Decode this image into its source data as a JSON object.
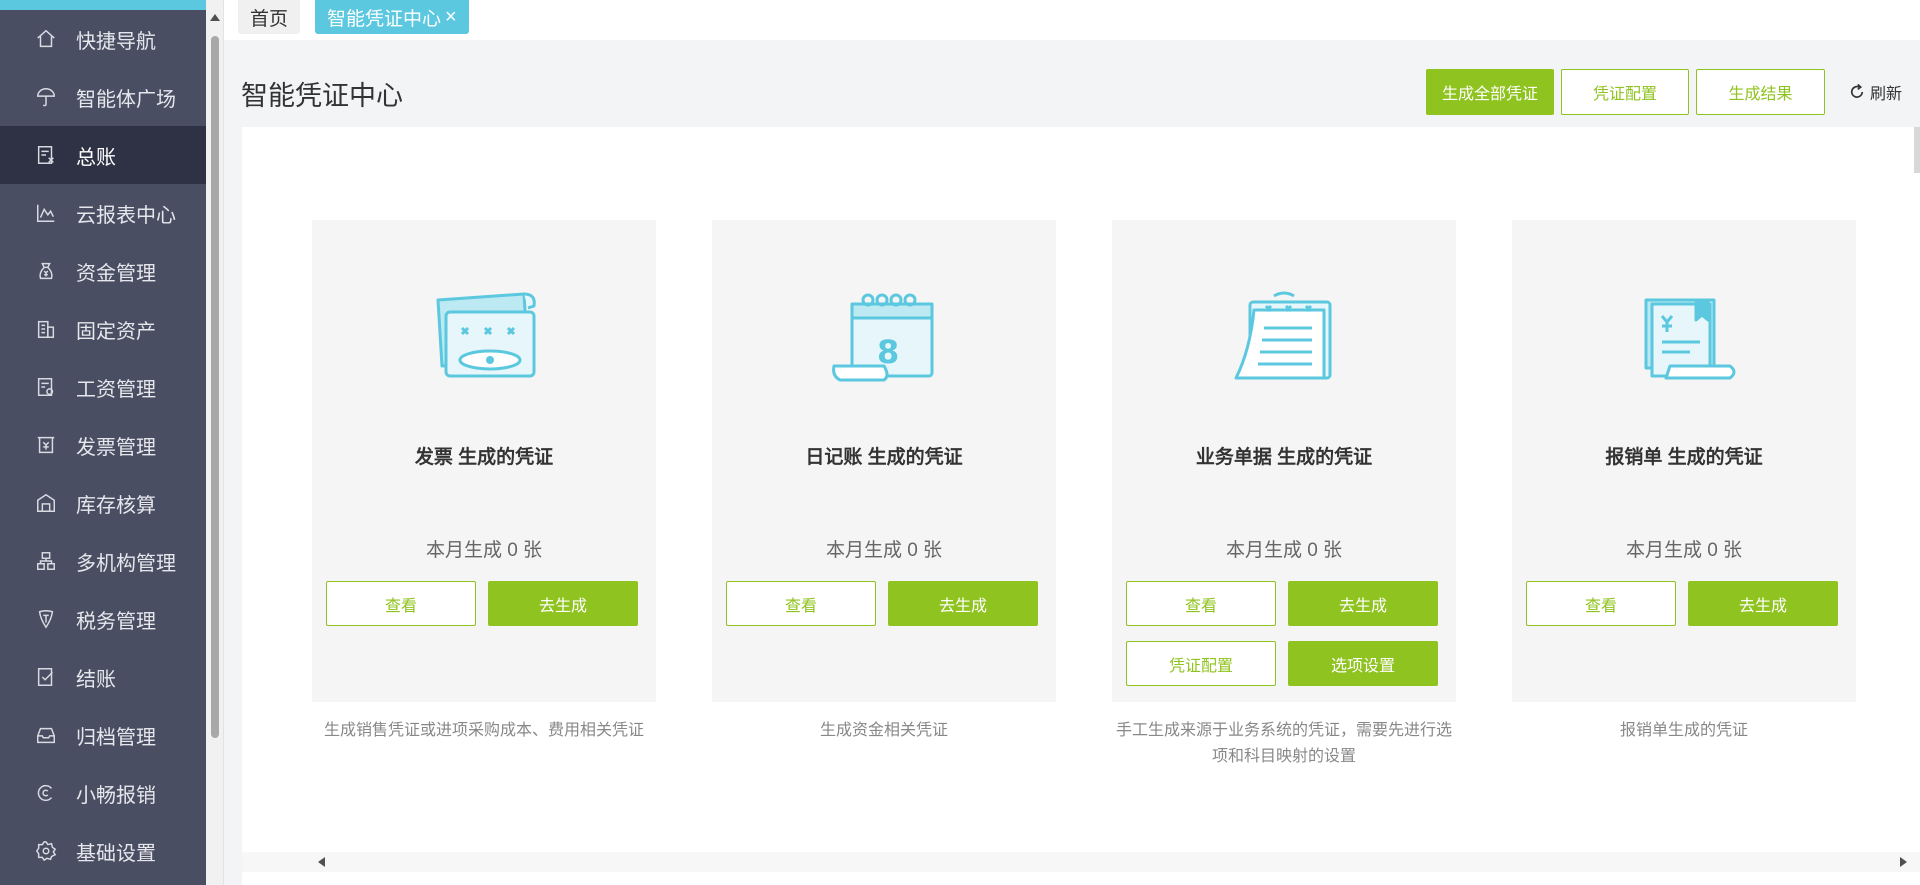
{
  "sidebar": {
    "items": [
      {
        "label": "快捷导航",
        "icon": "home-icon"
      },
      {
        "label": "智能体广场",
        "icon": "umbrella-icon"
      },
      {
        "label": "总账",
        "icon": "ledger-icon",
        "active": true
      },
      {
        "label": "云报表中心",
        "icon": "chart-icon"
      },
      {
        "label": "资金管理",
        "icon": "money-bag-icon"
      },
      {
        "label": "固定资产",
        "icon": "building-icon"
      },
      {
        "label": "工资管理",
        "icon": "salary-icon"
      },
      {
        "label": "发票管理",
        "icon": "invoice-icon"
      },
      {
        "label": "库存核算",
        "icon": "warehouse-icon"
      },
      {
        "label": "多机构管理",
        "icon": "org-icon"
      },
      {
        "label": "税务管理",
        "icon": "tax-icon"
      },
      {
        "label": "结账",
        "icon": "checkout-icon"
      },
      {
        "label": "归档管理",
        "icon": "archive-icon"
      },
      {
        "label": "小畅报销",
        "icon": "reimburse-icon"
      },
      {
        "label": "基础设置",
        "icon": "gear-icon"
      }
    ]
  },
  "tabs": {
    "home": "首页",
    "active": "智能凭证中心",
    "close": "×"
  },
  "header": {
    "title": "智能凭证中心",
    "generate_all": "生成全部凭证",
    "voucher_config": "凭证配置",
    "gen_result": "生成结果",
    "refresh": "刷新"
  },
  "cards": [
    {
      "title": "发票 生成的凭证",
      "stat": "本月生成 0 张",
      "view": "查看",
      "generate": "去生成",
      "desc": "生成销售凭证或进项采购成本、费用相关凭证"
    },
    {
      "title": "日记账 生成的凭证",
      "stat": "本月生成 0 张",
      "view": "查看",
      "generate": "去生成",
      "desc": "生成资金相关凭证"
    },
    {
      "title": "业务单据 生成的凭证",
      "stat": "本月生成 0 张",
      "view": "查看",
      "generate": "去生成",
      "config": "凭证配置",
      "options": "选项设置",
      "desc": "手工生成来源于业务系统的凭证，需要先进行选项和科目映射的设置"
    },
    {
      "title": "报销单 生成的凭证",
      "stat": "本月生成 0 张",
      "view": "查看",
      "generate": "去生成",
      "desc": "报销单生成的凭证"
    }
  ],
  "colors": {
    "accent": "#8fc31f",
    "tab": "#5bc8df",
    "sidebar": "#4a4e63",
    "sidebar_active": "#2f3245",
    "illustration": "#5bc8df"
  }
}
